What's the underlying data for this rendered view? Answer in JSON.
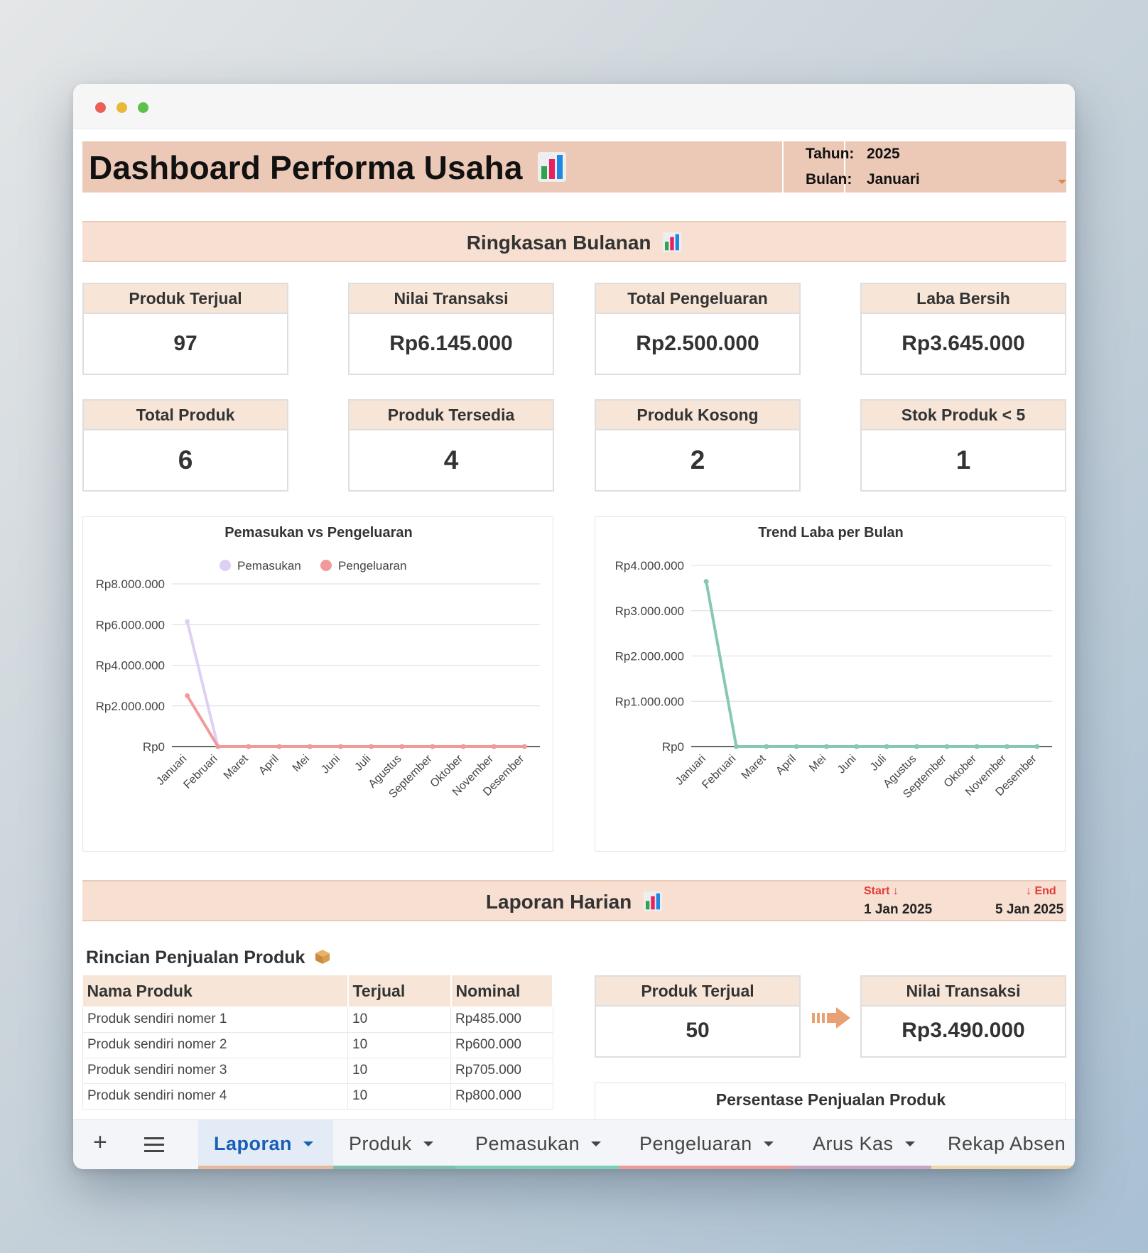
{
  "header": {
    "title": "Dashboard Performa Usaha",
    "tahun_label": "Tahun:",
    "tahun_value": "2025",
    "bulan_label": "Bulan:",
    "bulan_value": "Januari"
  },
  "ringkasan": {
    "title": "Ringkasan Bulanan",
    "cards": [
      {
        "label": "Produk Terjual",
        "value": "97"
      },
      {
        "label": "Nilai Transaksi",
        "value": "Rp6.145.000"
      },
      {
        "label": "Total Pengeluaran",
        "value": "Rp2.500.000"
      },
      {
        "label": "Laba Bersih",
        "value": "Rp3.645.000"
      },
      {
        "label": "Total Produk",
        "value": "6"
      },
      {
        "label": "Produk Tersedia",
        "value": "4"
      },
      {
        "label": "Produk Kosong",
        "value": "2"
      },
      {
        "label": "Stok Produk < 5",
        "value": "1"
      }
    ]
  },
  "chart_data": [
    {
      "type": "line",
      "title": "Pemasukan vs Pengeluaran",
      "categories": [
        "Januari",
        "Februari",
        "Maret",
        "April",
        "Mei",
        "Juni",
        "Juli",
        "Agustus",
        "September",
        "Oktober",
        "November",
        "Desember"
      ],
      "series": [
        {
          "name": "Pemasukan",
          "color": "#ddd0f4",
          "values": [
            6145000,
            0,
            0,
            0,
            0,
            0,
            0,
            0,
            0,
            0,
            0,
            0
          ]
        },
        {
          "name": "Pengeluaran",
          "color": "#f19a9a",
          "values": [
            2500000,
            0,
            0,
            0,
            0,
            0,
            0,
            0,
            0,
            0,
            0,
            0
          ]
        }
      ],
      "ylim": [
        0,
        8000000
      ],
      "yticks": [
        "Rp0",
        "Rp2.000.000",
        "Rp4.000.000",
        "Rp6.000.000",
        "Rp8.000.000"
      ],
      "legend": "top",
      "grid": true
    },
    {
      "type": "line",
      "title": "Trend Laba per Bulan",
      "categories": [
        "Januari",
        "Februari",
        "Maret",
        "April",
        "Mei",
        "Juni",
        "Juli",
        "Agustus",
        "September",
        "Oktober",
        "November",
        "Desember"
      ],
      "series": [
        {
          "color": "#86c7b6",
          "values": [
            3645000,
            0,
            0,
            0,
            0,
            0,
            0,
            0,
            0,
            0,
            0,
            0
          ]
        }
      ],
      "ylim": [
        0,
        4000000
      ],
      "yticks": [
        "Rp0",
        "Rp1.000.000",
        "Rp2.000.000",
        "Rp3.000.000",
        "Rp4.000.000"
      ],
      "grid": true
    }
  ],
  "harian": {
    "title": "Laporan Harian",
    "start_label": "Start",
    "end_label": "End",
    "start_date": "1 Jan 2025",
    "end_date": "5 Jan 2025",
    "subtitle": "Rincian Penjualan Produk",
    "table_headers": [
      "Nama Produk",
      "Terjual",
      "Nominal"
    ],
    "table_rows": [
      [
        "Produk sendiri nomer 1",
        "10",
        "Rp485.000"
      ],
      [
        "Produk sendiri nomer 2",
        "10",
        "Rp600.000"
      ],
      [
        "Produk sendiri nomer 3",
        "10",
        "Rp705.000"
      ],
      [
        "Produk sendiri nomer 4",
        "10",
        "Rp800.000"
      ]
    ],
    "card_terjual": {
      "label": "Produk Terjual",
      "value": "50"
    },
    "card_transaksi": {
      "label": "Nilai Transaksi",
      "value": "Rp3.490.000"
    },
    "pie_title": "Persentase Penjualan Produk"
  },
  "tabs": [
    {
      "label": "Laporan",
      "color": "#e8b89f",
      "active": true
    },
    {
      "label": "Produk",
      "color": "#7fbfb0"
    },
    {
      "label": "Pemasukan",
      "color": "#7fcfb8"
    },
    {
      "label": "Pengeluaran",
      "color": "#ee9b9b"
    },
    {
      "label": "Arus Kas",
      "color": "#c9a6c6"
    },
    {
      "label": "Rekap Absen",
      "color": "#f1d8a8"
    }
  ],
  "colors": {
    "accent": "#ecc9b7",
    "band": "#f7dfd2",
    "card_head": "#f7e6d8"
  },
  "icons": {
    "chart": "bar-chart-icon",
    "box": "package-icon",
    "arrow": "arrow-right-icon",
    "add": "plus-icon",
    "menu": "menu-icon"
  }
}
